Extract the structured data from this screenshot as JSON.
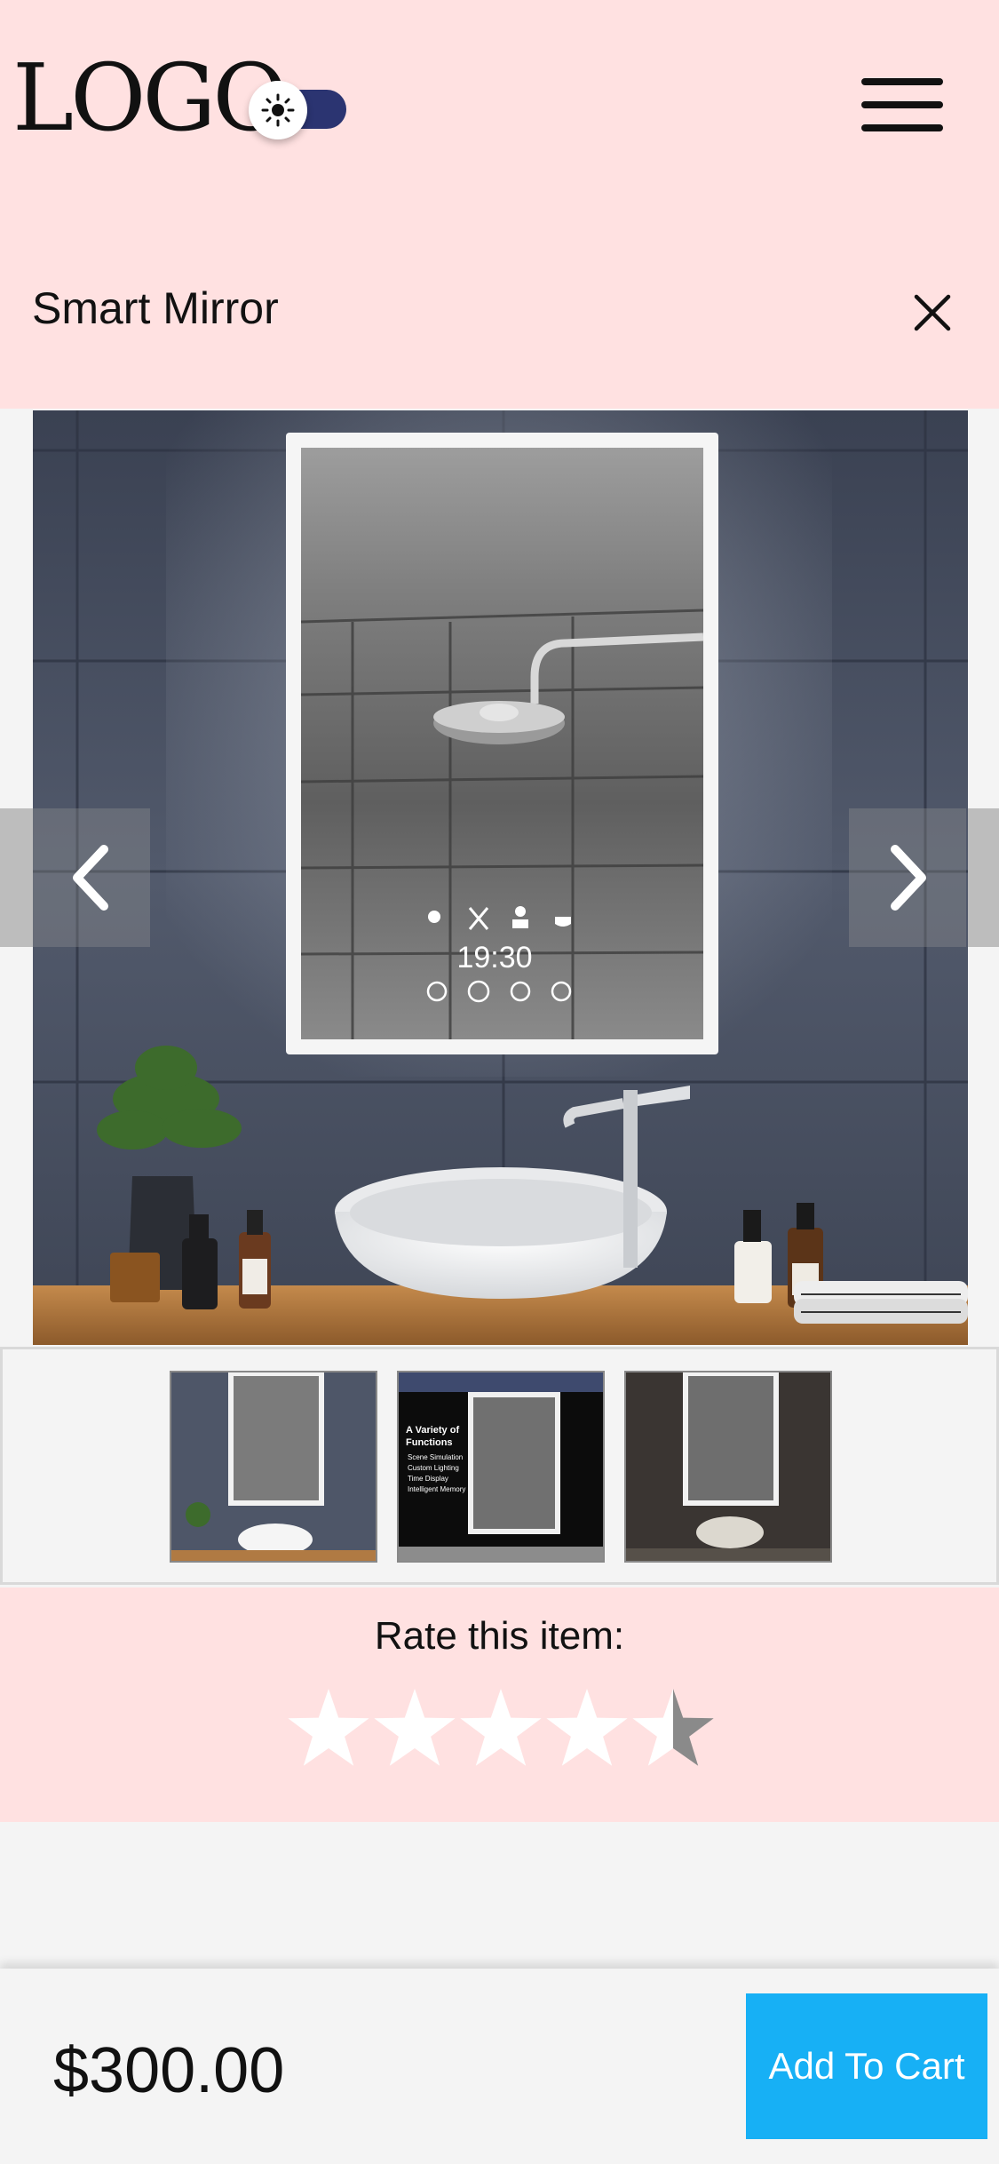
{
  "header": {
    "logo": "LOGO",
    "theme_toggle_icon": "sun-icon",
    "menu_icon": "hamburger-menu-icon"
  },
  "product": {
    "title": "Smart Mirror",
    "close_icon": "close-icon",
    "mirror_time": "19:30",
    "gallery_prev_icon": "chevron-left-icon",
    "gallery_next_icon": "chevron-right-icon",
    "thumbnails": [
      {
        "caption_lines": []
      },
      {
        "caption_lines": [
          "A Variety of",
          "Functions",
          "Scene Simulation",
          "Custom Lighting",
          "Time Display",
          "Intelligent Memory"
        ]
      },
      {
        "caption_lines": []
      }
    ]
  },
  "rating": {
    "label": "Rate this item:",
    "value": 4.5,
    "max": 5
  },
  "footer": {
    "price": "$300.00",
    "add_to_cart_label": "Add To Cart"
  },
  "colors": {
    "header_bg": "#ffe1e1",
    "toggle_track": "#2b3471",
    "cart_button": "#17b0f5",
    "star_filled": "#ffffff",
    "star_empty": "#8a8a8a"
  }
}
